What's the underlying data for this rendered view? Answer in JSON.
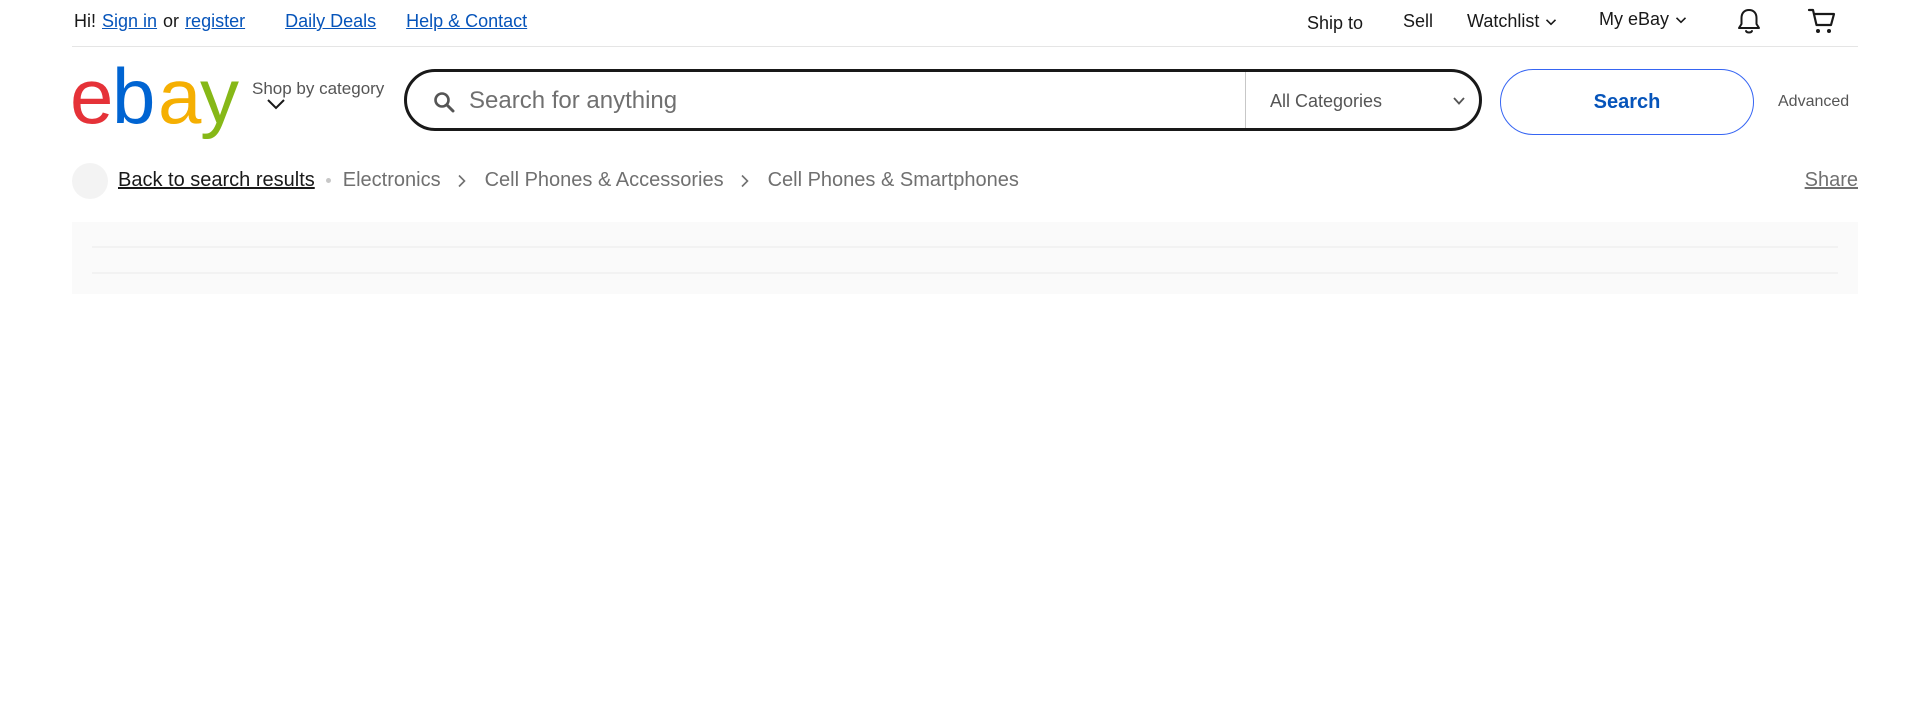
{
  "topbar": {
    "greeting": "Hi!",
    "sign_in": "Sign in",
    "or": "or",
    "register": "register",
    "daily_deals": "Daily Deals",
    "help_contact": "Help & Contact",
    "ship_to": "Ship to",
    "sell": "Sell",
    "watchlist": "Watchlist",
    "my_ebay": "My eBay"
  },
  "header": {
    "shop_by_category": "Shop by category",
    "search_placeholder": "Search for anything",
    "category_selected": "All Categories",
    "search_button": "Search",
    "advanced": "Advanced"
  },
  "breadcrumbs": {
    "back": "Back to search results",
    "items": [
      "Electronics",
      "Cell Phones & Accessories",
      "Cell Phones & Smartphones"
    ],
    "share": "Share"
  },
  "logo": {
    "letters": [
      "e",
      "b",
      "a",
      "y"
    ],
    "colors": [
      "#e53238",
      "#0064d2",
      "#f5af02",
      "#86b817"
    ]
  },
  "colors": {
    "link_blue": "#0654ba",
    "button_border": "#3665f3",
    "text_dark": "#191919",
    "text_muted": "#707070"
  }
}
